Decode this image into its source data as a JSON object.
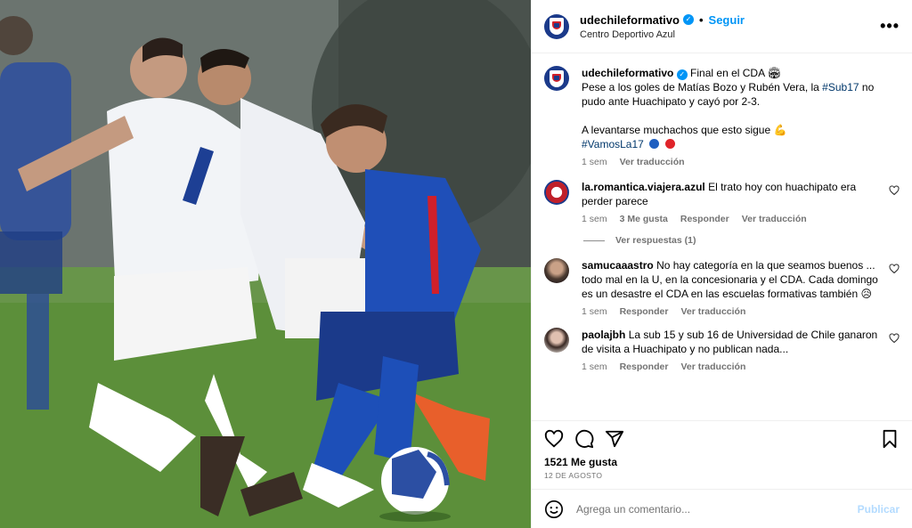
{
  "post": {
    "username": "udechileformativo",
    "follow_label": "Seguir",
    "location": "Centro Deportivo Azul",
    "more_label": "•••"
  },
  "caption": {
    "username": "udechileformativo",
    "title": "Final en el CDA 🏟",
    "line1": "Pese a los goles de Matías Bozo y Rubén Vera, la",
    "hashtag1": "#Sub17",
    "line2": "no pudo ante Huachipato y cayó por 2-3.",
    "line3": "A levantarse muchachos que esto sigue 💪",
    "hashtag2": "#VamosLa17",
    "time": "1 sem",
    "translate": "Ver traducción"
  },
  "comments": [
    {
      "username": "la.romantica.viajera.azul",
      "text": "El trato hoy con huachipato era perder parece",
      "time": "1 sem",
      "likes": "3 Me gusta",
      "reply": "Responder",
      "translate": "Ver traducción",
      "replies_label": "Ver respuestas (1)"
    },
    {
      "username": "samucaaastro",
      "text": "No hay categoría en la que seamos buenos ... todo mal en la U, en la concesionaria y el CDA. Cada domingo es un desastre el CDA en las escuelas formativas también 😥",
      "time": "1 sem",
      "reply": "Responder",
      "translate": "Ver traducción"
    },
    {
      "username": "paolajbh",
      "text": "La sub 15 y sub 16 de Universidad de Chile ganaron de visita a Huachipato y no publican nada...",
      "time": "1 sem",
      "reply": "Responder",
      "translate": "Ver traducción"
    }
  ],
  "stats": {
    "likes": "1521 Me gusta",
    "date": "12 DE AGOSTO"
  },
  "composer": {
    "placeholder": "Agrega un comentario...",
    "publish_label": "Publicar"
  },
  "colors": {
    "accent": "#0095f6",
    "hashtag": "#00376b",
    "brand_blue": "#1b3a8a",
    "brand_red": "#d0202a"
  },
  "icons": [
    "heart-icon",
    "comment-icon",
    "share-icon",
    "bookmark-icon",
    "emoji-icon",
    "verified-icon",
    "more-icon"
  ]
}
